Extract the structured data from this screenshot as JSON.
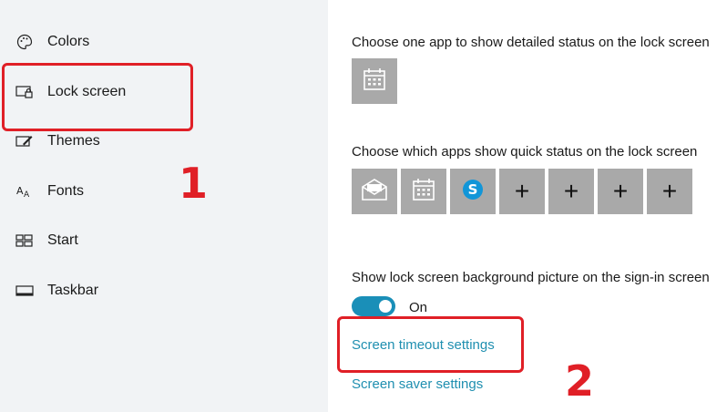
{
  "sidebar": {
    "items": [
      {
        "label": "Colors",
        "icon": "palette-icon"
      },
      {
        "label": "Lock screen",
        "icon": "lock-screen-icon"
      },
      {
        "label": "Themes",
        "icon": "themes-icon"
      },
      {
        "label": "Fonts",
        "icon": "fonts-icon"
      },
      {
        "label": "Start",
        "icon": "start-icon"
      },
      {
        "label": "Taskbar",
        "icon": "taskbar-icon"
      }
    ]
  },
  "main": {
    "detailed_status_heading": "Choose one app to show detailed status on the lock screen",
    "detailed_status_app": "calendar-icon",
    "quick_status_heading": "Choose which apps show quick status on the lock screen",
    "quick_status_apps": [
      "mail-icon",
      "calendar-icon",
      "skype-icon",
      "add-icon",
      "add-icon",
      "add-icon",
      "add-icon"
    ],
    "background_heading": "Show lock screen background picture on the sign-in screen",
    "toggle_state": "On",
    "timeout_link": "Screen timeout settings",
    "saver_link": "Screen saver settings"
  },
  "annotations": {
    "step1": "1",
    "step2": "2"
  },
  "colors": {
    "highlight": "#e01f26",
    "accent": "#1a8fb8",
    "link": "#1f8fb0",
    "tile": "#a9a9a9",
    "sidebar": "#f1f3f5"
  }
}
